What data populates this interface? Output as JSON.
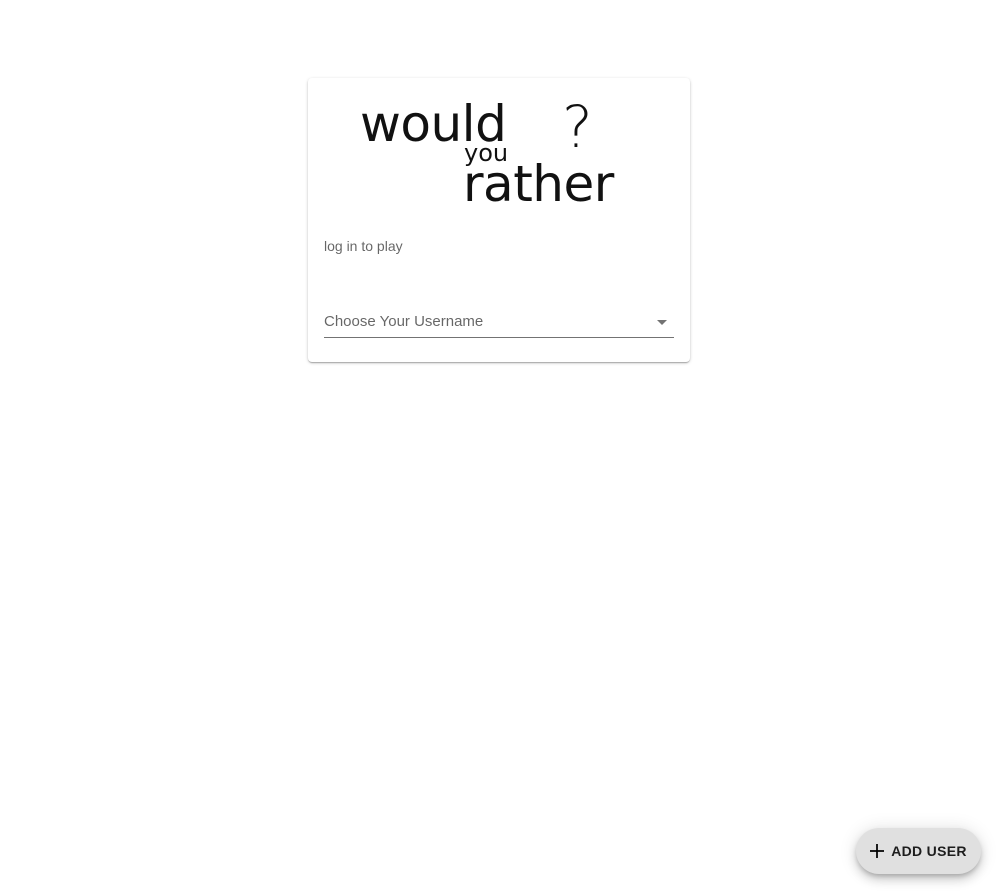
{
  "logo": {
    "word_would": "would",
    "word_you": "you",
    "word_rather": "rather",
    "question_mark": "?"
  },
  "login": {
    "subtitle": "log in to play",
    "username_select_label": "Choose Your Username",
    "dropdown_icon": "arrow-drop-down-icon"
  },
  "fab": {
    "icon": "plus-icon",
    "label": "ADD USER"
  }
}
